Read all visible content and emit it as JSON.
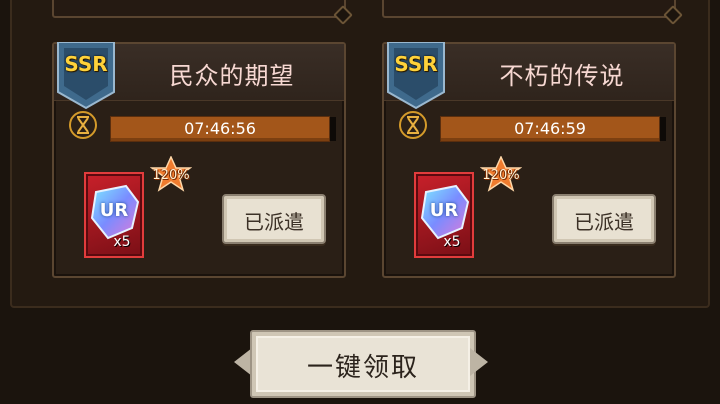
{
  "missions": [
    {
      "rarity": "SSR",
      "title": "民众的期望",
      "timer": "07:46:56",
      "reward": {
        "tier": "UR",
        "quantity": "x5",
        "bonus": "120%"
      },
      "status_button": "已派遣"
    },
    {
      "rarity": "SSR",
      "title": "不朽的传说",
      "timer": "07:46:59",
      "reward": {
        "tier": "UR",
        "quantity": "x5",
        "bonus": "120%"
      },
      "status_button": "已派遣"
    }
  ],
  "collect_all_label": "一键领取",
  "colors": {
    "rarity_gold": "#ffd23a",
    "timer_bar": "#a3561a",
    "reward_frame": "#c8202a"
  },
  "icons": {
    "timer": "hourglass-icon",
    "reward": "ur-gem-icon",
    "bonus": "star-badge-icon"
  }
}
